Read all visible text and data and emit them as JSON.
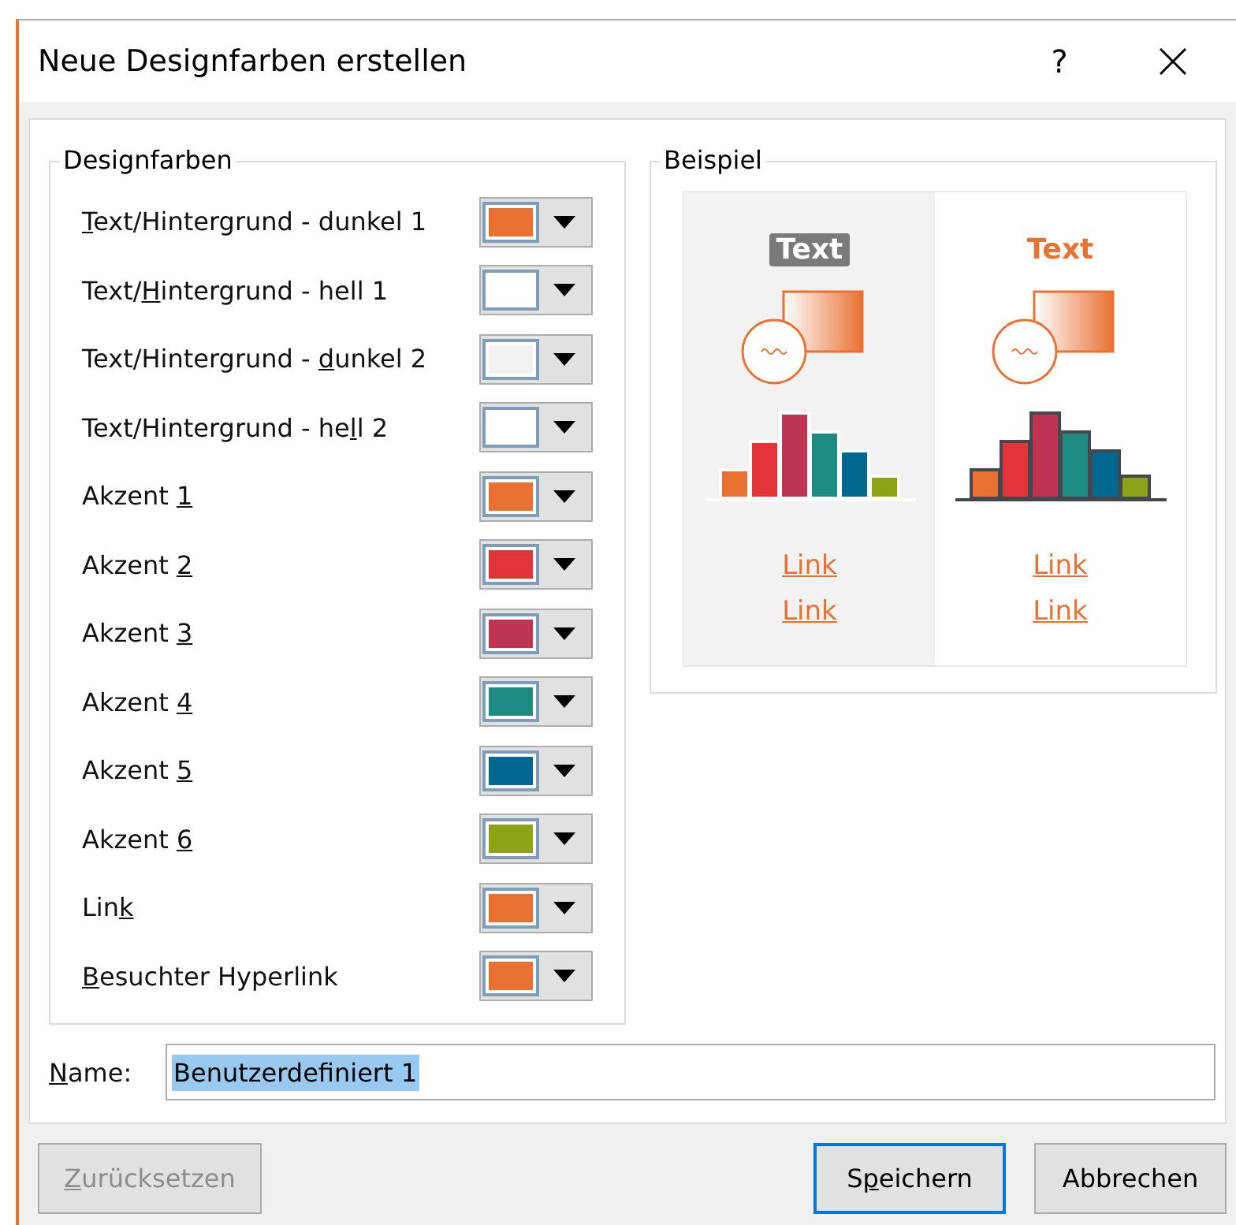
{
  "window": {
    "title": "Neue Designfarben erstellen",
    "help": "?"
  },
  "theme_colors": {
    "title": "Designfarben",
    "items": [
      {
        "label": {
          "key": "T",
          "post": "ext/Hintergrund - dunkel 1"
        },
        "color": "#e97132"
      },
      {
        "label": {
          "pre": "Text/",
          "key": "H",
          "post": "intergrund - hell 1"
        },
        "color": "#ffffff"
      },
      {
        "label": {
          "pre": "Text/Hintergrund - ",
          "key": "d",
          "post": "unkel 2"
        },
        "color": "#f2f2f2"
      },
      {
        "label": {
          "pre": "Text/Hintergrund - he",
          "key": "l",
          "post": "l 2"
        },
        "color": "#ffffff"
      },
      {
        "label": {
          "pre": "Akzent ",
          "key": "1"
        },
        "color": "#e97132"
      },
      {
        "label": {
          "pre": "Akzent ",
          "key": "2"
        },
        "color": "#e3343a"
      },
      {
        "label": {
          "pre": "Akzent ",
          "key": "3"
        },
        "color": "#be3455"
      },
      {
        "label": {
          "pre": "Akzent ",
          "key": "4"
        },
        "color": "#1e8b82"
      },
      {
        "label": {
          "pre": "Akzent ",
          "key": "5"
        },
        "color": "#036890"
      },
      {
        "label": {
          "pre": "Akzent ",
          "key": "6"
        },
        "color": "#8ba314"
      },
      {
        "label": {
          "pre": "Lin",
          "key": "k"
        },
        "color": "#e97132"
      },
      {
        "label": {
          "key": "B",
          "post": "esuchter Hyperlink"
        },
        "color": "#e97132"
      }
    ]
  },
  "sample": {
    "title": "Beispiel",
    "panels": [
      {
        "kind": "dark",
        "heading": "Text",
        "links": [
          "Link",
          "Link"
        ]
      },
      {
        "kind": "light",
        "heading": "Text",
        "links": [
          "Link",
          "Link"
        ]
      }
    ]
  },
  "name_field": {
    "label": {
      "key": "N",
      "post": "ame:"
    },
    "value": "Benutzerdefiniert 1"
  },
  "buttons": [
    {
      "label": {
        "key": "Z",
        "post": "urücksetzen"
      },
      "disabled": true,
      "default": false
    },
    {
      "label": {
        "pre": "S",
        "key": "p",
        "post": "eichern"
      },
      "disabled": false,
      "default": true
    },
    {
      "label": {
        "pre": "Abbrechen"
      },
      "disabled": false,
      "default": false
    }
  ]
}
